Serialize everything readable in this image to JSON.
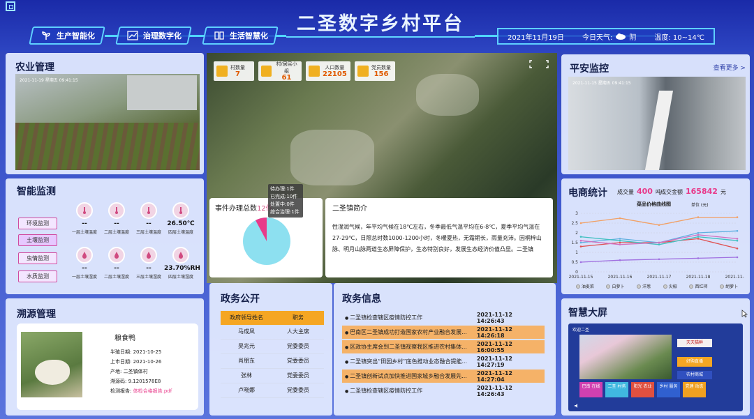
{
  "header": {
    "title": "二圣数字乡村平台",
    "tabs": [
      {
        "label": "生产智能化",
        "icon": "sprout-icon"
      },
      {
        "label": "治理数字化",
        "icon": "chart-icon"
      },
      {
        "label": "生活智慧化",
        "icon": "book-icon"
      }
    ],
    "date": "2021年11月19日",
    "weather_label": "今日天气:",
    "weather": "阴",
    "temp_label": "温度:",
    "temp": "10~14℃"
  },
  "agriculture": {
    "title": "农业管理",
    "cam_time": "2021-11-19 星期五 09:41:15"
  },
  "stats": [
    {
      "label": "村数量",
      "value": "7",
      "icon": "home-icon"
    },
    {
      "label": "村/居民小组",
      "value": "61",
      "icon": "building-icon"
    },
    {
      "label": "人口数量",
      "value": "22105",
      "icon": "people-icon"
    },
    {
      "label": "党员数量",
      "value": "156",
      "icon": "party-icon"
    }
  ],
  "security": {
    "title": "平安监控",
    "more": "查看更多 >",
    "cam_time": "2021-11-15 星期五 09:41:15"
  },
  "monitor": {
    "title": "智能监测",
    "buttons": [
      "环境监测",
      "土壤监测",
      "虫情监测",
      "水质监测"
    ],
    "row1": [
      {
        "value": "--",
        "label": "一层土壤温度"
      },
      {
        "value": "--",
        "label": "二层土壤温度"
      },
      {
        "value": "--",
        "label": "三层土壤温度"
      },
      {
        "value": "26.50℃",
        "label": "四层土壤温度"
      }
    ],
    "row2": [
      {
        "value": "--",
        "label": "一层土壤湿度"
      },
      {
        "value": "--",
        "label": "二层土壤湿度"
      },
      {
        "value": "--",
        "label": "三层土壤湿度"
      },
      {
        "value": "23.70%RH",
        "label": "四层土壤湿度"
      }
    ]
  },
  "events": {
    "title": "事件办理总数",
    "total": "12件",
    "tooltip": [
      "待办理:1件",
      "已完成:10件",
      "处置中:0件",
      "综合治理:1件"
    ]
  },
  "town": {
    "title": "二圣镇简介",
    "text": "性湿润气候，年平均气候在18℃左右，冬季最低气温平均在6-8℃，夏季平均气温在27-29℃，日照总时数1000-1200小时，冬暖夏热，无霜期长，雨量充沛。因桐梓山脉、明月山脉两道生态屏障保护，生态特别良好，发展生态经济价值凸显。二圣镇"
  },
  "ecommerce": {
    "title": "电商统计",
    "volume_label": "成交量",
    "volume": "400",
    "volume_unit": "吨",
    "amount_label": "成交金额",
    "amount": "165842",
    "amount_unit": "元"
  },
  "chart_data": {
    "type": "line",
    "title": "菜品价格曲线图",
    "ylabel": "单位 (元)",
    "ylim": [
      0,
      3
    ],
    "yticks": [
      "0",
      "0.5",
      "1",
      "1.5",
      "2",
      "2.5",
      "3"
    ],
    "categories": [
      "2021-11-15",
      "2021-11-16",
      "2021-11-17",
      "2021-11-18",
      "2021-11-19"
    ],
    "series": [
      {
        "name": "油麦菜",
        "color": "#f2a064",
        "values": [
          2.5,
          2.75,
          2.4,
          2.8,
          2.8
        ]
      },
      {
        "name": "白萝卜",
        "color": "#e05050",
        "values": [
          1.3,
          1.5,
          1.5,
          1.7,
          1.2
        ]
      },
      {
        "name": "洋葱",
        "color": "#a070e0",
        "values": [
          0.5,
          0.6,
          0.65,
          0.7,
          0.75
        ]
      },
      {
        "name": "尖椒",
        "color": "#60b0e0",
        "values": [
          1.5,
          1.7,
          1.5,
          2.0,
          2.1
        ]
      },
      {
        "name": "西红柿",
        "color": "#40c0c0",
        "values": [
          1.8,
          1.6,
          1.4,
          1.8,
          1.6
        ]
      },
      {
        "name": "胡萝卜",
        "color": "#d070c0",
        "values": [
          1.6,
          1.4,
          1.5,
          1.9,
          1.7
        ]
      }
    ]
  },
  "gov": {
    "title": "政务公开",
    "headers": [
      "政府领导姓名",
      "职务"
    ],
    "rows": [
      [
        "马成凤",
        "人大主席"
      ],
      [
        "吴兆元",
        "党委委员"
      ],
      [
        "肖朋东",
        "党委委员"
      ],
      [
        "张林",
        "党委委员"
      ],
      [
        "卢晓娜",
        "党委委员"
      ]
    ]
  },
  "news": {
    "title": "政务信息",
    "items": [
      {
        "text": "二圣镇检查辖区疫情防控工作",
        "date": "2021-11-12 14:26:43",
        "hl": false
      },
      {
        "text": "巴南区二圣镇成功打造国家农村产业融合发展...",
        "date": "2021-11-12 14:26:18",
        "hl": true
      },
      {
        "text": "区政协主席会到二圣镇视察我区推进农村集体...",
        "date": "2021-11-12 16:00:55",
        "hl": true
      },
      {
        "text": "二圣镇突出“田园乡村”底色推动业态融合提能...",
        "date": "2021-11-12 14:27:19",
        "hl": false
      },
      {
        "text": "二圣镇创新试点加快推进国家城乡融合发展先...",
        "date": "2021-11-12 14:27:04",
        "hl": true
      },
      {
        "text": "二圣镇检查辖区疫情防控工作",
        "date": "2021-11-12 14:26:43",
        "hl": false
      }
    ]
  },
  "trace": {
    "title": "溯源管理",
    "product": "粮食鸭",
    "fields": [
      {
        "label": "半殖日期:",
        "value": "2021-10-25"
      },
      {
        "label": "上市日期:",
        "value": "2021-10-26"
      },
      {
        "label": "产地:",
        "value": "二圣镇体村"
      },
      {
        "label": "溯源码:",
        "value": "9.1201578E8"
      },
      {
        "label": "检测报告:",
        "value": "体检合格报告.pdf"
      }
    ]
  },
  "smart": {
    "title": "智慧大屏",
    "screen_title": "欢迎二圣",
    "tiles": [
      "巴南 在线",
      "二圣 村务",
      "阳光 农业",
      "乡村 服务",
      "党建 动态"
    ],
    "tile_colors": [
      "#d040b0",
      "#40b8e0",
      "#e05040",
      "#3060d0",
      "#f0a020"
    ],
    "side_items": [
      "天天猫鲜",
      "好购直播",
      "农村商城"
    ]
  }
}
